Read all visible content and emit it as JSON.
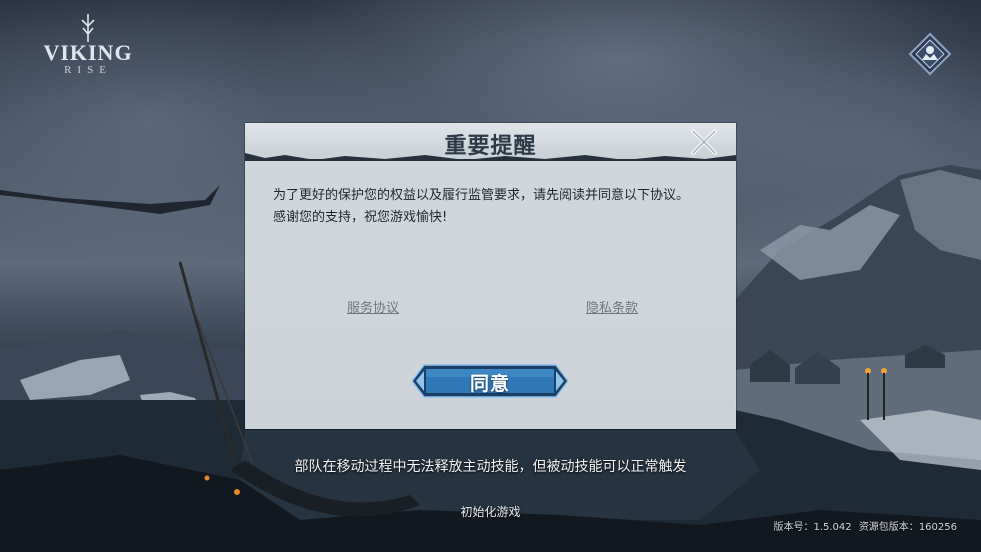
{
  "logo": {
    "title": "VIKING",
    "subtitle": "RISE"
  },
  "dialog": {
    "title": "重要提醒",
    "lines": [
      "为了更好的保护您的权益以及履行监管要求，请先阅读并同意以下协议。",
      "感谢您的支持，祝您游戏愉快!"
    ],
    "links": {
      "service": "服务协议",
      "privacy": "隐私条款"
    },
    "agree_label": "同意"
  },
  "tip": "部队在移动过程中无法释放主动技能，但被动技能可以正常触发",
  "init_label": "初始化游戏",
  "version": {
    "version_label": "版本号：",
    "version_value": "1.5.042",
    "resource_label": "资源包版本：",
    "resource_value": "160256"
  }
}
